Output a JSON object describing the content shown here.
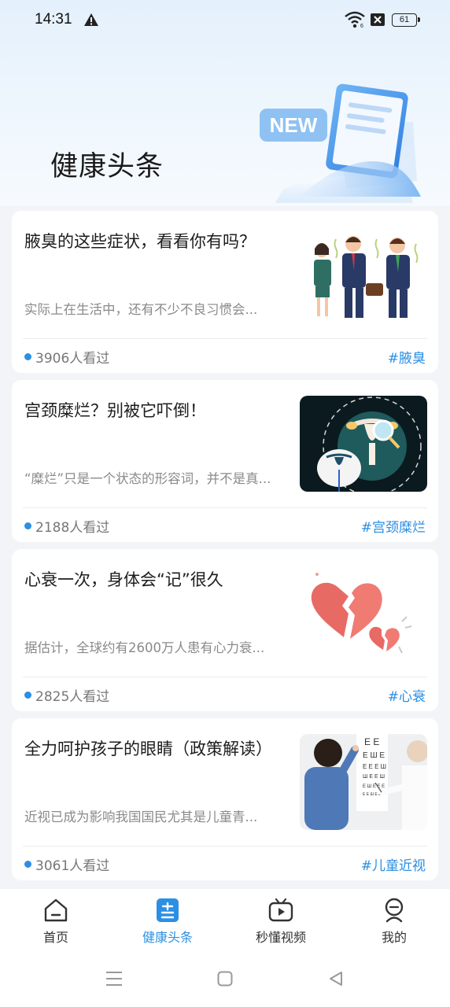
{
  "status_bar": {
    "time": "14:31",
    "battery": "61",
    "icons": [
      "warning-icon",
      "wifi-icon",
      "no-sim-icon",
      "battery-icon"
    ]
  },
  "header": {
    "title": "健康头条",
    "badge": "NEW"
  },
  "articles": [
    {
      "title": "腋臭的这些症状，看看你有吗？",
      "summary": "实际上在生活中，还有不少不良习惯会...",
      "views": "3906人看过",
      "tag": "#腋臭",
      "thumb": "office-people-illustration"
    },
    {
      "title": "宫颈糜烂？别被它吓倒！",
      "summary": "“糜烂”只是一个状态的形容词，并不是真...",
      "views": "2188人看过",
      "tag": "#宫颈糜烂",
      "thumb": "uterus-magnifier-illustration"
    },
    {
      "title": "心衰一次，身体会“记”很久",
      "summary": "据估计，全球约有2600万人患有心力衰...",
      "views": "2825人看过",
      "tag": "#心衰",
      "thumb": "broken-heart-illustration"
    },
    {
      "title": "全力呵护孩子的眼睛（政策解读）",
      "summary": "近视已成为影响我国国民尤其是儿童青...",
      "views": "3061人看过",
      "tag": "#儿童近视",
      "thumb": "eye-chart-photo"
    }
  ],
  "bottom_nav": [
    {
      "label": "首页",
      "icon": "home-icon",
      "active": false
    },
    {
      "label": "健康头条",
      "icon": "headlines-icon",
      "active": true
    },
    {
      "label": "秒懂视频",
      "icon": "tv-icon",
      "active": false
    },
    {
      "label": "我的",
      "icon": "profile-icon",
      "active": false
    }
  ],
  "colors": {
    "accent": "#2b8fe3",
    "background": "#f2f4f7",
    "header_gradient_top": "#e4f0fc"
  }
}
